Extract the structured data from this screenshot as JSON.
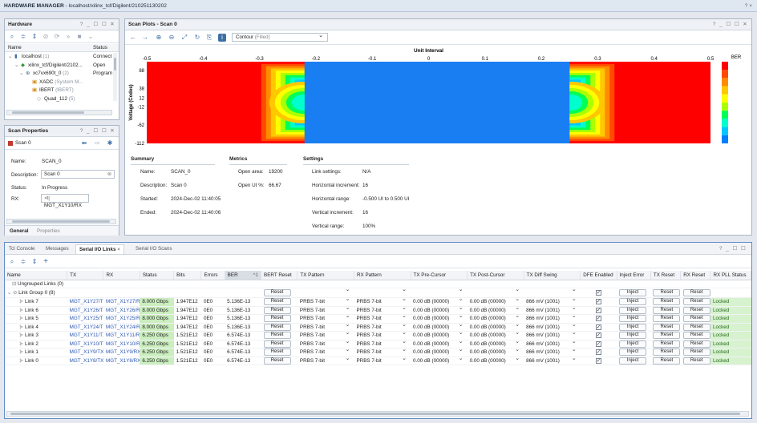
{
  "window": {
    "title": "HARDWARE MANAGER",
    "subtitle": " - localhost/xilinx_tcf/Digilent/210251130202",
    "controls": "? ×"
  },
  "hardware": {
    "title": "Hardware",
    "controls": "? _ ☐ ☐ ✕",
    "cols": {
      "name": "Name",
      "status": "Status"
    },
    "rows": [
      {
        "label": "localhost",
        "extra": " (1)",
        "status": "Connect"
      },
      {
        "label": "xilinx_tcf/Digilent/2102...",
        "extra": "",
        "status": "Open"
      },
      {
        "label": "xc7vx690t_0",
        "extra": " (2)",
        "status": "Program"
      },
      {
        "label": "XADC",
        "extra": " (System M...",
        "status": ""
      },
      {
        "label": "IBERT",
        "extra": " (IBERT)",
        "status": ""
      },
      {
        "label": "Quad_112",
        "extra": " (5)",
        "status": ""
      }
    ]
  },
  "scan_props": {
    "title": "Scan Properties",
    "controls": "? _ ☐ ☐ ✕",
    "scan": "Scan 0",
    "name_label": "Name:",
    "name": "SCAN_0",
    "desc_label": "Description:",
    "desc": "Scan 0",
    "status_label": "Status:",
    "status": "In Progress",
    "rx_label": "RX:",
    "rx": "MGT_X1Y10/RX",
    "tabs": {
      "general": "General",
      "properties": "Properties"
    }
  },
  "scan_plots": {
    "title": "Scan Plots - Scan 0",
    "controls": "? _ ☐ ☐ ✕",
    "plot_type": "Contour",
    "plot_type_sub": " (Filled)"
  },
  "chart_data": {
    "type": "heatmap",
    "title": "Unit Interval",
    "xlabel": "Unit Interval",
    "ylabel": "Voltage (Codes)",
    "x_ticks": [
      -0.5,
      -0.4,
      -0.3,
      -0.2,
      -0.1,
      0,
      0.1,
      0.2,
      0.3,
      0.4,
      0.5
    ],
    "y_ticks": [
      88,
      38,
      12,
      -12,
      -62,
      -112
    ],
    "xlim": [
      -0.5,
      0.5
    ],
    "ylim": [
      -112,
      112
    ],
    "colorbar_label": "BER",
    "colorbar_colors": [
      "#ff0000",
      "#ff4a00",
      "#ff8c00",
      "#ffc800",
      "#ffff00",
      "#aaff00",
      "#00ff55",
      "#00ffcc",
      "#00c8ff",
      "#0080ff"
    ],
    "open_region": {
      "x": [
        -0.22,
        0.25
      ],
      "y": [
        -112,
        112
      ]
    },
    "color_open": "#1a7ef3",
    "color_closed": "#ff0000"
  },
  "summary": {
    "title": "Summary",
    "items": [
      {
        "k": "Name:",
        "v": "SCAN_0"
      },
      {
        "k": "Description:",
        "v": "Scan 0"
      },
      {
        "k": "Started:",
        "v": "2024-Dec-02 11:40:05"
      },
      {
        "k": "Ended:",
        "v": "2024-Dec-02 11:40:06"
      }
    ]
  },
  "metrics": {
    "title": "Metrics",
    "items": [
      {
        "k": "Open area:",
        "v": "19200"
      },
      {
        "k": "Open UI %:",
        "v": "66.67"
      }
    ]
  },
  "settings": {
    "title": "Settings",
    "items": [
      {
        "k": "Link settings:",
        "v": "N/A"
      },
      {
        "k": "Horizontal increment:",
        "v": "16"
      },
      {
        "k": "Horizontal range:",
        "v": "-0.500 UI to 0.500 UI"
      },
      {
        "k": "Vertical increment:",
        "v": "16"
      },
      {
        "k": "Vertical range:",
        "v": "100%"
      }
    ]
  },
  "bottom": {
    "tabs": [
      "Tcl Console",
      "Messages",
      "Serial I/O Links",
      "Serial I/O Scans"
    ],
    "controls": "? _ ☐ ☐",
    "cols": [
      "Name",
      "TX",
      "RX",
      "Status",
      "Bits",
      "Errors",
      "BER",
      "BERT Reset",
      "TX Pattern",
      "RX Pattern",
      "TX Pre-Cursor",
      "TX Post-Cursor",
      "TX Diff Swing",
      "DFE Enabled",
      "Inject Error",
      "TX Reset",
      "RX Reset",
      "RX PLL Status"
    ],
    "ber_sort": "^1",
    "ungrouped": "Ungrouped Links (0)",
    "group": "Link Group 0 (8)",
    "btn_reset": "Reset",
    "btn_inject": "Inject",
    "links": [
      {
        "name": "Link 7",
        "tx": "MGT_X1Y27/TX",
        "rx": "MGT_X1Y27/RX",
        "status": "8.000 Gbps",
        "bits": "1.947E12",
        "errors": "0E0",
        "ber": "5.136E-13",
        "txp": "PRBS 7-bit",
        "rxp": "PRBS 7-bit",
        "pre": "0.00 dB (00000)",
        "post": "0.00 dB (00000)",
        "swing": "866 mV (1001)",
        "pll": "Locked"
      },
      {
        "name": "Link 6",
        "tx": "MGT_X1Y26/TX",
        "rx": "MGT_X1Y26/RX",
        "status": "8.000 Gbps",
        "bits": "1.947E12",
        "errors": "0E0",
        "ber": "5.136E-13",
        "txp": "PRBS 7-bit",
        "rxp": "PRBS 7-bit",
        "pre": "0.00 dB (00000)",
        "post": "0.00 dB (00000)",
        "swing": "866 mV (1001)",
        "pll": "Locked"
      },
      {
        "name": "Link 5",
        "tx": "MGT_X1Y25/TX",
        "rx": "MGT_X1Y25/RX",
        "status": "8.000 Gbps",
        "bits": "1.947E12",
        "errors": "0E0",
        "ber": "5.136E-13",
        "txp": "PRBS 7-bit",
        "rxp": "PRBS 7-bit",
        "pre": "0.00 dB (00000)",
        "post": "0.00 dB (00000)",
        "swing": "866 mV (1001)",
        "pll": "Locked"
      },
      {
        "name": "Link 4",
        "tx": "MGT_X1Y24/TX",
        "rx": "MGT_X1Y24/RX",
        "status": "8.000 Gbps",
        "bits": "1.947E12",
        "errors": "0E0",
        "ber": "5.136E-13",
        "txp": "PRBS 7-bit",
        "rxp": "PRBS 7-bit",
        "pre": "0.00 dB (00000)",
        "post": "0.00 dB (00000)",
        "swing": "866 mV (1001)",
        "pll": "Locked"
      },
      {
        "name": "Link 3",
        "tx": "MGT_X1Y11/TX",
        "rx": "MGT_X1Y11/RX",
        "status": "6.250 Gbps",
        "bits": "1.521E12",
        "errors": "0E0",
        "ber": "6.574E-13",
        "txp": "PRBS 7-bit",
        "rxp": "PRBS 7-bit",
        "pre": "0.00 dB (00000)",
        "post": "0.00 dB (00000)",
        "swing": "866 mV (1001)",
        "pll": "Locked"
      },
      {
        "name": "Link 2",
        "tx": "MGT_X1Y10/TX",
        "rx": "MGT_X1Y10/RX",
        "status": "6.250 Gbps",
        "bits": "1.521E12",
        "errors": "0E0",
        "ber": "6.574E-13",
        "txp": "PRBS 7-bit",
        "rxp": "PRBS 7-bit",
        "pre": "0.00 dB (00000)",
        "post": "0.00 dB (00000)",
        "swing": "866 mV (1001)",
        "pll": "Locked"
      },
      {
        "name": "Link 1",
        "tx": "MGT_X1Y9/TX",
        "rx": "MGT_X1Y9/RX",
        "status": "6.250 Gbps",
        "bits": "1.521E12",
        "errors": "0E0",
        "ber": "6.574E-13",
        "txp": "PRBS 7-bit",
        "rxp": "PRBS 7-bit",
        "pre": "0.00 dB (00000)",
        "post": "0.00 dB (00000)",
        "swing": "866 mV (1001)",
        "pll": "Locked"
      },
      {
        "name": "Link 0",
        "tx": "MGT_X1Y8/TX",
        "rx": "MGT_X1Y8/RX",
        "status": "6.250 Gbps",
        "bits": "1.521E12",
        "errors": "0E0",
        "ber": "6.574E-13",
        "txp": "PRBS 7-bit",
        "rxp": "PRBS 7-bit",
        "pre": "0.00 dB (00000)",
        "post": "0.00 dB (00000)",
        "swing": "866 mV (1001)",
        "pll": "Locked"
      }
    ]
  }
}
